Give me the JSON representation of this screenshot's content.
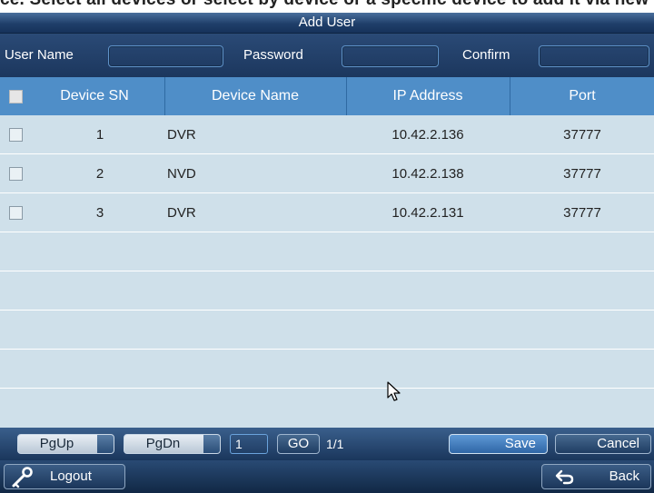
{
  "top_strip_text": "ce. Select all devices or select by device or a specific device to add it via new user.",
  "dialog": {
    "title": "Add User"
  },
  "form": {
    "username_label": "User Name",
    "username_value": "",
    "password_label": "Password",
    "password_value": "",
    "confirm_label": "Confirm",
    "confirm_value": ""
  },
  "table": {
    "columns": [
      "Device SN",
      "Device Name",
      "IP Address",
      "Port"
    ],
    "rows": [
      {
        "sn": "1",
        "name": "DVR",
        "ip": "10.42.2.136",
        "port": "37777"
      },
      {
        "sn": "2",
        "name": "NVD",
        "ip": "10.42.2.138",
        "port": "37777"
      },
      {
        "sn": "3",
        "name": "DVR",
        "ip": "10.42.2.131",
        "port": "37777"
      }
    ]
  },
  "pager": {
    "pgup_label": "PgUp",
    "pgdn_label": "PgDn",
    "page_value": "1",
    "go_label": "GO",
    "page_total": "1/1",
    "save_label": "Save",
    "cancel_label": "Cancel"
  },
  "footer": {
    "logout_label": "Logout",
    "back_label": "Back"
  },
  "icons": {
    "logout": "key-icon",
    "back": "return-arrow-icon",
    "cursor": "mouse-pointer-icon"
  },
  "colors": {
    "header_blue": "#4f8ec8",
    "row_bg": "#cfe0ea",
    "titlebar": "#1f3f6a"
  }
}
